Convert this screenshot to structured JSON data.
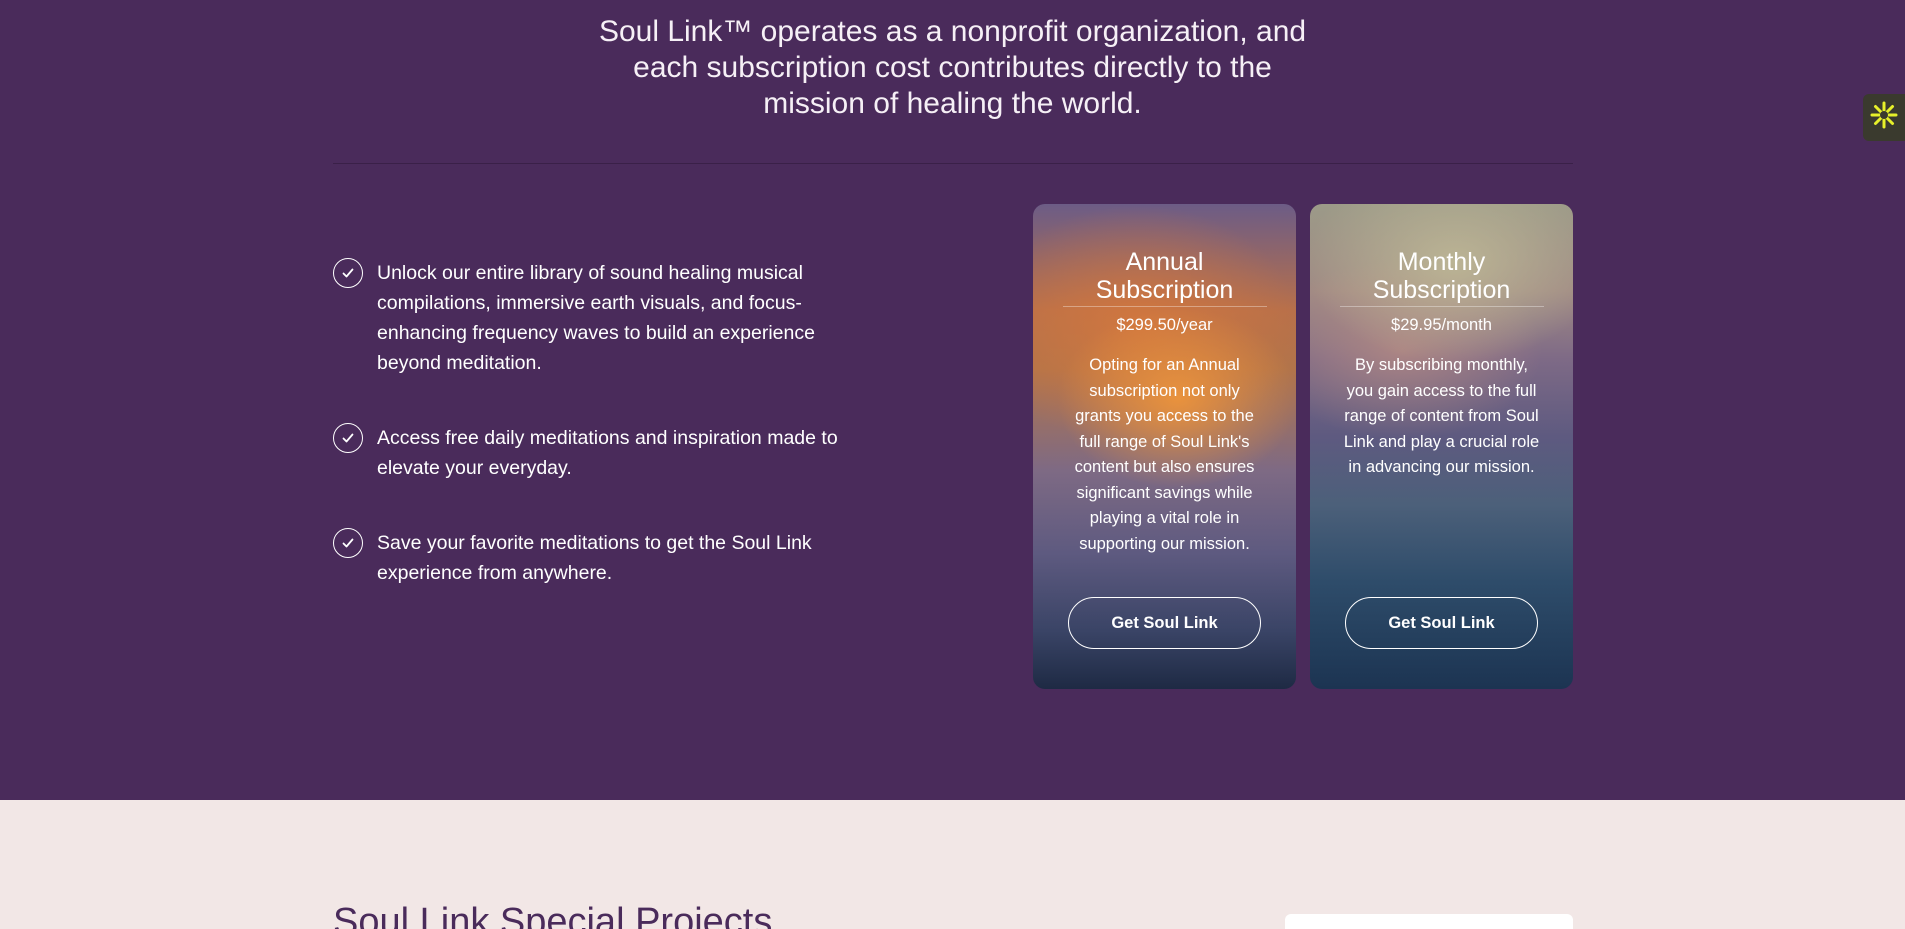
{
  "intro": {
    "line1": "Soul Link™ operates as a nonprofit organization, and",
    "line2": "each subscription cost contributes directly to the",
    "line3": "mission of healing the world."
  },
  "benefits": [
    {
      "icon": "check-circle-icon",
      "text": "Unlock our entire library of sound healing musical compilations, immersive earth visuals, and focus-enhancing frequency waves to build an experience beyond meditation."
    },
    {
      "icon": "check-circle-icon",
      "text": "Access free daily meditations and inspiration made to elevate your everyday."
    },
    {
      "icon": "check-circle-icon",
      "text": "Save your favorite meditations to get the Soul Link experience from anywhere."
    }
  ],
  "plans": [
    {
      "title": "Annual Subscription",
      "price": "$299.50/year",
      "description": "Opting for an Annual subscription not only grants you access to the full range of Soul Link's content but also ensures significant savings while playing a vital role in supporting our mission.",
      "button": "Get Soul Link"
    },
    {
      "title": "Monthly Subscription",
      "price": "$29.95/month",
      "description": "By subscribing monthly, you gain access to the full range of content from Soul Link and play a crucial role in advancing our mission.",
      "button": "Get Soul Link"
    }
  ],
  "widget": {
    "icon": "asterisk-icon"
  },
  "projects": {
    "title": "Soul Link Special Projects"
  },
  "colors": {
    "background": "#4a2b5b",
    "light_background": "#f2e7e6",
    "widget_icon": "#e6f02a"
  }
}
